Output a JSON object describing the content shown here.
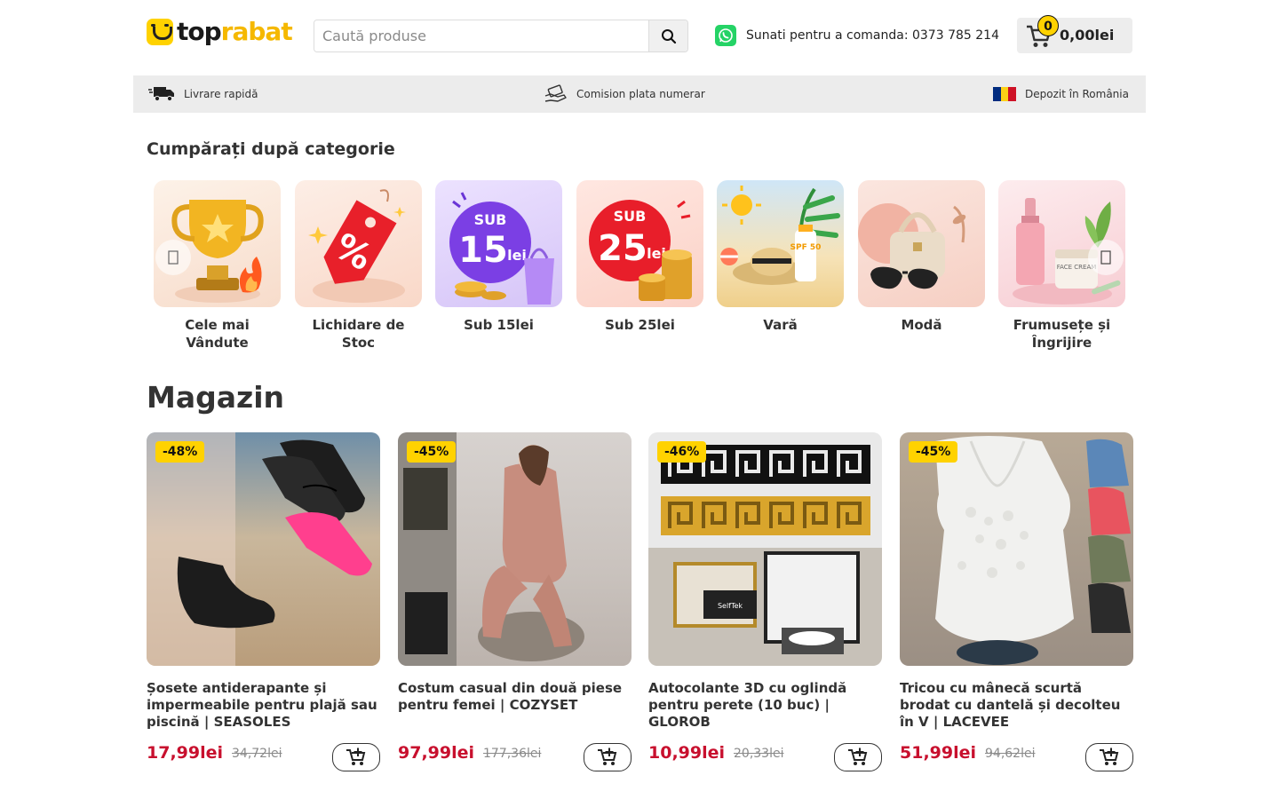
{
  "header": {
    "logo_top": "top",
    "logo_rabat": "rabat",
    "search_placeholder": "Caută produse",
    "phone_text": "Sunati pentru a comanda: 0373 785 214",
    "cart_count": "0",
    "cart_total": "0,00lei"
  },
  "benefits": [
    {
      "label": "Livrare rapidă",
      "icon": "truck-icon"
    },
    {
      "label": "Comision plata numerar",
      "icon": "cash-hand-icon"
    },
    {
      "label": "Depozit în România",
      "icon": "romania-flag-icon"
    }
  ],
  "categories": {
    "title": "Cumpărați după categorie",
    "items": [
      {
        "label": "Cele mai Vândute",
        "icon": "trophy-icon"
      },
      {
        "label": "Lichidare de Stoc",
        "icon": "discount-tag-icon"
      },
      {
        "label": "Sub 15lei",
        "icon": "sub15-icon",
        "badge_top": "SUB",
        "badge_value": "15",
        "badge_unit": "lei"
      },
      {
        "label": "Sub 25lei",
        "icon": "sub25-icon",
        "badge_top": "SUB",
        "badge_value": "25",
        "badge_unit": "lei"
      },
      {
        "label": "Vară",
        "icon": "summer-icon",
        "spf": "SPF 50"
      },
      {
        "label": "Modă",
        "icon": "fashion-icon"
      },
      {
        "label": "Frumusețe și Îngrijire",
        "icon": "beauty-icon",
        "jar_text": "FACE CREAM"
      }
    ]
  },
  "shop": {
    "title": "Magazin",
    "products": [
      {
        "badge": "-48%",
        "title": "Șosete antiderapante și impermeabile pentru plajă sau piscină | SEASOLES",
        "price": "17,99lei",
        "old_price": "34,72lei"
      },
      {
        "badge": "-45%",
        "title": "Costum casual din două piese pentru femei | COZYSET",
        "price": "97,99lei",
        "old_price": "177,36lei"
      },
      {
        "badge": "-46%",
        "title": "Autocolante 3D cu oglindă pentru perete (10 buc) | GLOROB",
        "price": "10,99lei",
        "old_price": "20,33lei",
        "screen_text": "SelfTek"
      },
      {
        "badge": "-45%",
        "title": "Tricou cu mânecă scurtă brodat cu dantelă și decolteu în V | LACEVEE",
        "price": "51,99lei",
        "old_price": "94,62lei"
      }
    ]
  },
  "colors": {
    "accent_yellow": "#ffd200",
    "price_red": "#c8102e",
    "whatsapp_green": "#25d366"
  }
}
